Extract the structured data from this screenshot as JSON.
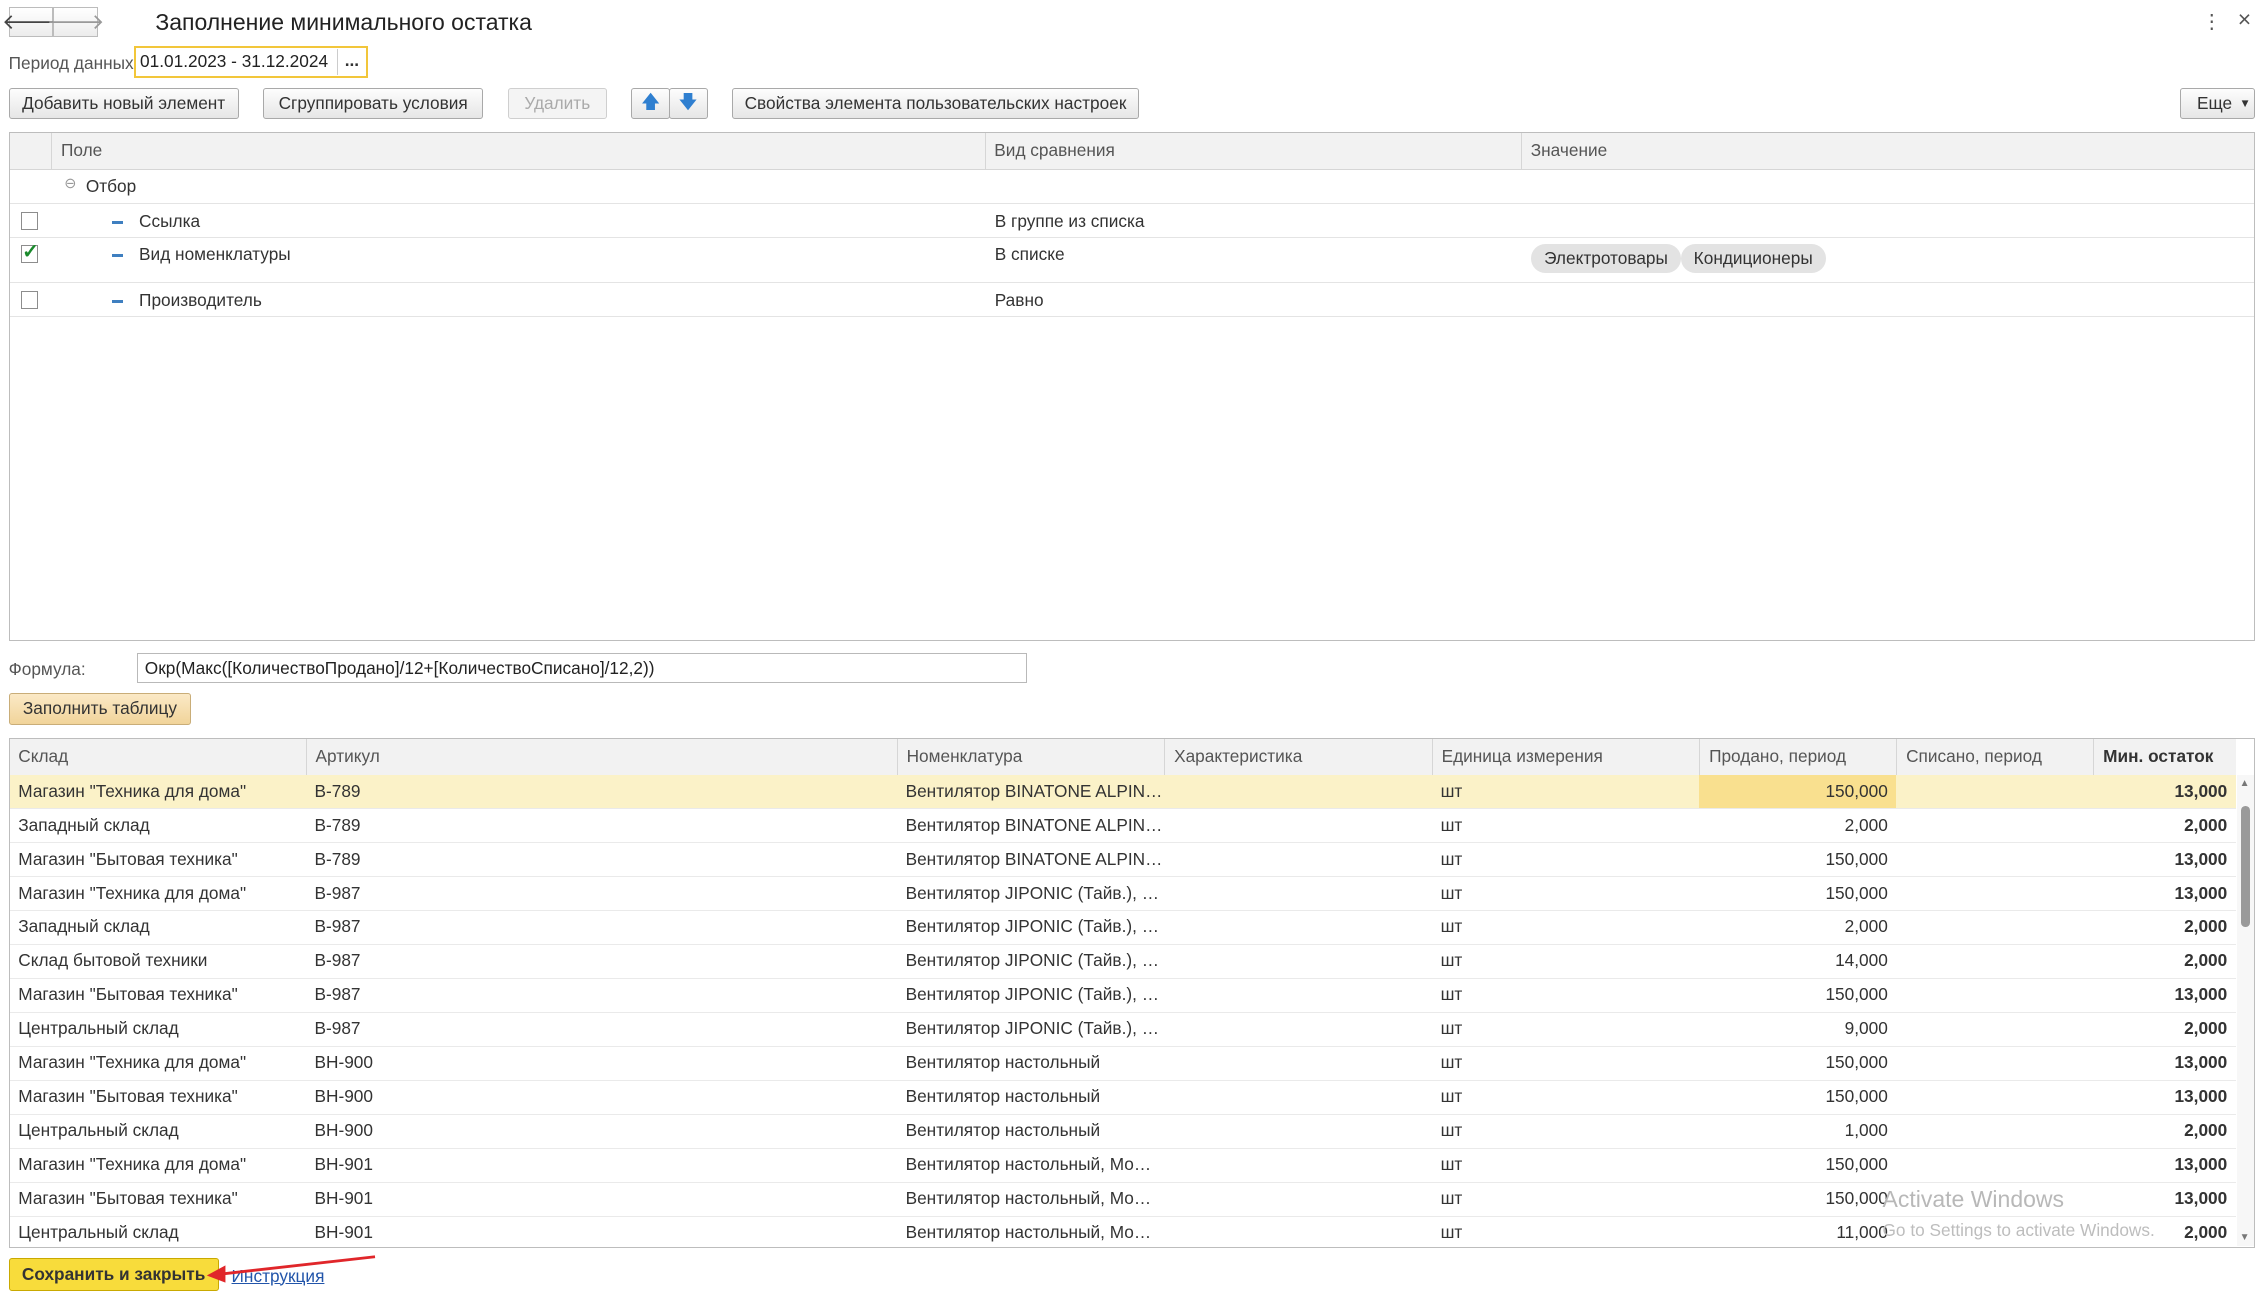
{
  "window": {
    "title": "Заполнение минимального остатка",
    "more_icon": "⋮",
    "close_icon": "×"
  },
  "period": {
    "label": "Период данных:",
    "value": "01.01.2023 - 31.12.2024",
    "choose": "..."
  },
  "toolbar": {
    "add": "Добавить новый элемент",
    "group": "Сгруппировать условия",
    "delete": "Удалить",
    "up": "🡅",
    "down": "🡇",
    "props": "Свойства элемента пользовательских настроек",
    "more": "Еще"
  },
  "filter": {
    "columns": [
      "Поле",
      "Вид сравнения",
      "Значение"
    ],
    "group_label": "Отбор",
    "rows": [
      {
        "field": "Ссылка",
        "comparison": "В группе из списка",
        "checked": false,
        "values": []
      },
      {
        "field": "Вид номенклатуры",
        "comparison": "В списке",
        "checked": true,
        "values": [
          "Электротовары",
          "Кондиционеры"
        ]
      },
      {
        "field": "Производитель",
        "comparison": "Равно",
        "checked": false,
        "values": []
      }
    ]
  },
  "formula": {
    "label": "Формула:",
    "value": "Окр(Макс([КоличествоПродано]/12+[КоличествоСписано]/12,2))",
    "fill_button": "Заполнить таблицу"
  },
  "table": {
    "columns": [
      "Склад",
      "Артикул",
      "Номенклатура",
      "Характеристика",
      "Единица измерения",
      "Продано, период",
      "Списано, период",
      "Мин. остаток"
    ],
    "rows": [
      [
        "Магазин \"Техника для дома\"",
        "B-789",
        "Вентилятор BINATONE ALPIN…",
        "",
        "шт",
        "150,000",
        "",
        "13,000"
      ],
      [
        "Западный склад",
        "B-789",
        "Вентилятор BINATONE ALPIN…",
        "",
        "шт",
        "2,000",
        "",
        "2,000"
      ],
      [
        "Магазин \"Бытовая техника\"",
        "B-789",
        "Вентилятор BINATONE ALPIN…",
        "",
        "шт",
        "150,000",
        "",
        "13,000"
      ],
      [
        "Магазин \"Техника для дома\"",
        "B-987",
        "Вентилятор JIPONIC (Тайв.), …",
        "",
        "шт",
        "150,000",
        "",
        "13,000"
      ],
      [
        "Западный склад",
        "B-987",
        "Вентилятор JIPONIC (Тайв.), …",
        "",
        "шт",
        "2,000",
        "",
        "2,000"
      ],
      [
        "Склад бытовой техники",
        "B-987",
        "Вентилятор JIPONIC (Тайв.), …",
        "",
        "шт",
        "14,000",
        "",
        "2,000"
      ],
      [
        "Магазин \"Бытовая техника\"",
        "B-987",
        "Вентилятор JIPONIC (Тайв.), …",
        "",
        "шт",
        "150,000",
        "",
        "13,000"
      ],
      [
        "Центральный склад",
        "B-987",
        "Вентилятор JIPONIC (Тайв.), …",
        "",
        "шт",
        "9,000",
        "",
        "2,000"
      ],
      [
        "Магазин \"Техника для дома\"",
        "BH-900",
        "Вентилятор настольный",
        "",
        "шт",
        "150,000",
        "",
        "13,000"
      ],
      [
        "Магазин \"Бытовая техника\"",
        "BH-900",
        "Вентилятор настольный",
        "",
        "шт",
        "150,000",
        "",
        "13,000"
      ],
      [
        "Центральный склад",
        "BH-900",
        "Вентилятор настольный",
        "",
        "шт",
        "1,000",
        "",
        "2,000"
      ],
      [
        "Магазин \"Техника для дома\"",
        "BH-901",
        "Вентилятор настольный, Мо…",
        "",
        "шт",
        "150,000",
        "",
        "13,000"
      ],
      [
        "Магазин \"Бытовая техника\"",
        "BH-901",
        "Вентилятор настольный, Мо…",
        "",
        "шт",
        "150,000",
        "",
        "13,000"
      ],
      [
        "Центральный склад",
        "BH-901",
        "Вентилятор настольный, Мо…",
        "",
        "шт",
        "11,000",
        "",
        "2,000"
      ]
    ]
  },
  "watermark": {
    "line1": "Activate Windows",
    "line2": "Go to Settings to activate Windows."
  },
  "footer": {
    "save": "Сохранить и закрыть",
    "help": "Инструкция"
  }
}
